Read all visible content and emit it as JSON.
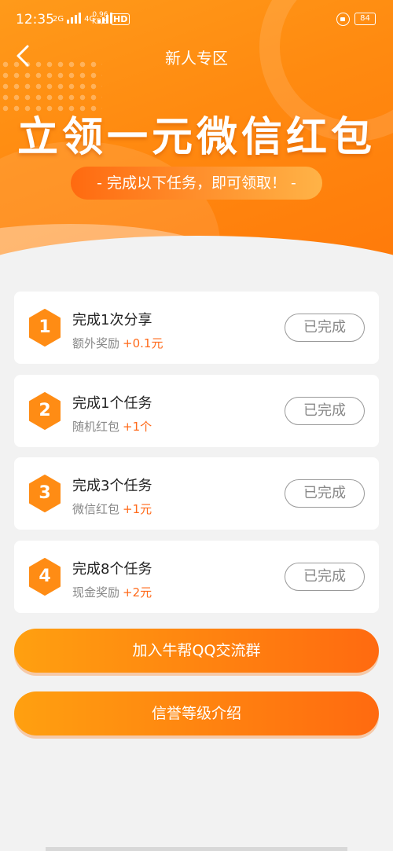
{
  "status_bar": {
    "time": "12:35",
    "signal1": "2G",
    "signal2": "4G",
    "net_speed": "0.96",
    "net_unit": "KB/S",
    "hd": "HD",
    "battery": "84"
  },
  "nav": {
    "back_icon": "chevron-left-icon",
    "title": "新人专区"
  },
  "hero": {
    "headline": "立领一元微信红包",
    "subtitle": "- 完成以下任务，即可领取！ -"
  },
  "tasks": [
    {
      "number": "1",
      "title": "完成1次分享",
      "reward_label": "额外奖励",
      "reward_value": "+0.1元",
      "status": "已完成"
    },
    {
      "number": "2",
      "title": "完成1个任务",
      "reward_label": "随机红包",
      "reward_value": "+1个",
      "status": "已完成"
    },
    {
      "number": "3",
      "title": "完成3个任务",
      "reward_label": "微信红包",
      "reward_value": "+1元",
      "status": "已完成"
    },
    {
      "number": "4",
      "title": "完成8个任务",
      "reward_label": "现金奖励",
      "reward_value": "+2元",
      "status": "已完成"
    }
  ],
  "actions": {
    "join_group": "加入牛帮QQ交流群",
    "credit_intro": "信誉等级介绍"
  },
  "colors": {
    "accent": "#ff8a10",
    "reward": "#ff6a1a",
    "background": "#f2f2f2"
  }
}
